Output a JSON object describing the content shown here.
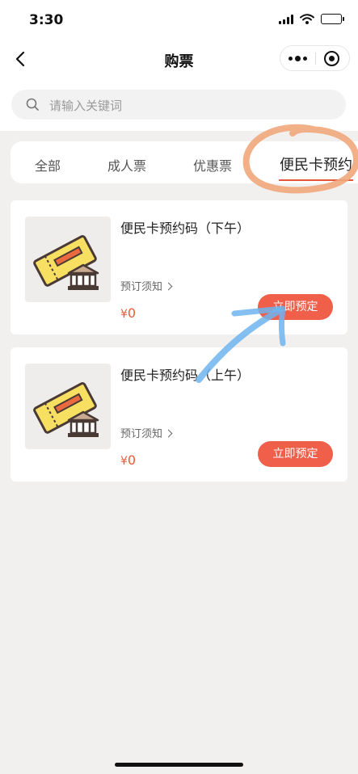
{
  "status_bar": {
    "time": "3:30"
  },
  "nav": {
    "title": "购票"
  },
  "search": {
    "placeholder": "请输入关键词"
  },
  "tabs": [
    {
      "label": "全部",
      "active": false
    },
    {
      "label": "成人票",
      "active": false
    },
    {
      "label": "优惠票",
      "active": false
    },
    {
      "label": "便民卡预约",
      "active": true
    }
  ],
  "tickets": [
    {
      "name": "便民卡预约码（下午）",
      "notice": "预订须知",
      "currency": "¥",
      "price": "0",
      "button": "立即预定"
    },
    {
      "name": "便民卡预约码（上午）",
      "notice": "预订须知",
      "currency": "¥",
      "price": "0",
      "button": "立即预定"
    }
  ],
  "colors": {
    "accent": "#ef5f49",
    "price": "#ea5a3a",
    "page_bg": "#f1f0ee",
    "annotation_circle": "#f0a77a",
    "annotation_arrow": "#6fb4f0"
  },
  "icons": [
    "signal-icon",
    "wifi-icon",
    "battery-icon",
    "back-arrow-icon",
    "more-icon",
    "target-icon",
    "search-icon",
    "ticket-museum-icon",
    "chevron-right-icon"
  ]
}
